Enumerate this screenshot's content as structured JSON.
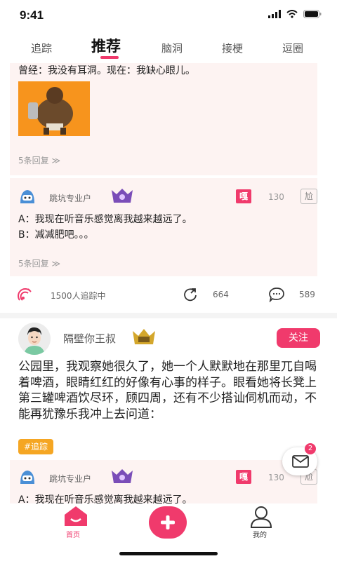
{
  "status_bar": {
    "time": "9:41"
  },
  "tabs": [
    {
      "label": "追踪"
    },
    {
      "label": "推荐"
    },
    {
      "label": "脑洞"
    },
    {
      "label": "接梗"
    },
    {
      "label": "逗圈"
    }
  ],
  "feed": {
    "reply1": {
      "text": "曾经：我没有耳洞。现在：我缺心眼儿。",
      "more_replies": "5条回复 ≫"
    },
    "reply2": {
      "user": "跳坑专业户",
      "ga_label": "嘎",
      "count": "130",
      "box_label": "尬",
      "lines": [
        "A：我现在听音乐感觉离我越来越远了。",
        "B：减减肥吧。。。"
      ],
      "more_replies": "5条回复 ≫"
    },
    "stats": {
      "followers": "1500人追踪中",
      "shares": "664",
      "comments": "589"
    },
    "post": {
      "author": "隔壁你王叔",
      "follow_label": "关注",
      "text": "公园里，我观察她很久了，她一个人默默地在那里兀自喝着啤酒，眼睛红红的好像有心事的样子。眼看她将长凳上第三罐啤酒饮尽环，顾四周，还有不少搭讪伺机而动，不能再犹豫乐我冲上去问道：",
      "tag": "#追踪"
    },
    "reply3": {
      "user": "跳坑专业户",
      "ga_label": "嘎",
      "count": "130",
      "box_label": "尬",
      "line": "A：我现在听音乐感觉离我越来越远了。"
    }
  },
  "floating_mail": {
    "badge": "2"
  },
  "bottom_nav": {
    "home": "首页",
    "mine": "我的"
  },
  "colors": {
    "accent": "#f03a6c",
    "tag": "#f5a623",
    "reply_bg": "#fdf3f2"
  }
}
